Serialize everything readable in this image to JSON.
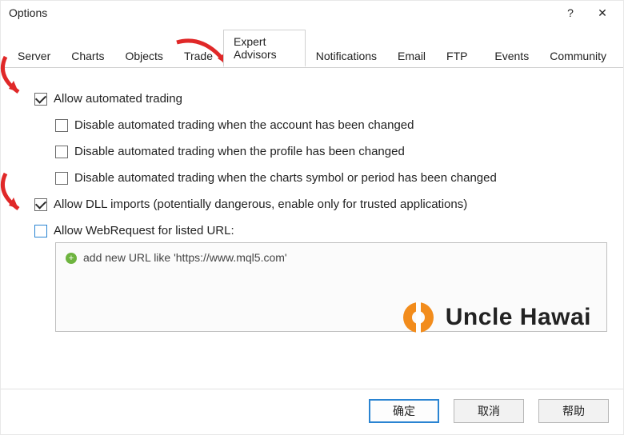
{
  "window": {
    "title": "Options",
    "help": "?",
    "close": "✕"
  },
  "tabs": [
    {
      "label": "Server"
    },
    {
      "label": "Charts"
    },
    {
      "label": "Objects"
    },
    {
      "label": "Trade"
    },
    {
      "label": "Expert Advisors",
      "active": true
    },
    {
      "label": "Notifications"
    },
    {
      "label": "Email"
    },
    {
      "label": "FTP"
    },
    {
      "label": "Events"
    },
    {
      "label": "Community"
    }
  ],
  "options": {
    "allow_auto": {
      "label": "Allow automated trading",
      "checked": true
    },
    "disable_account": {
      "label": "Disable automated trading when the account has been changed",
      "checked": false
    },
    "disable_profile": {
      "label": "Disable automated trading when the profile has been changed",
      "checked": false
    },
    "disable_symbol": {
      "label": "Disable automated trading when the charts symbol or period has been changed",
      "checked": false
    },
    "allow_dll": {
      "label": "Allow DLL imports (potentially dangerous, enable only for trusted applications)",
      "checked": true
    },
    "allow_web": {
      "label": "Allow WebRequest for listed URL:",
      "checked": false
    }
  },
  "url_hint": "add new URL like 'https://www.mql5.com'",
  "buttons": {
    "ok": "确定",
    "cancel": "取消",
    "help": "帮助"
  },
  "watermark": {
    "brand": "Uncle Hawai"
  }
}
